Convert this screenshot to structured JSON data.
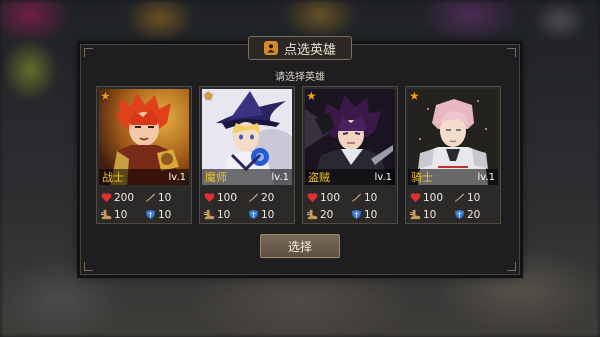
{
  "dialog": {
    "title": "点选英雄",
    "subtitle": "请选择英雄",
    "select_label": "选择"
  },
  "heroes": [
    {
      "name": "战士",
      "level": "lv.1",
      "hp": "200",
      "attack": "10",
      "speed": "10",
      "defense": "10"
    },
    {
      "name": "魔师",
      "level": "lv.1",
      "hp": "100",
      "attack": "20",
      "speed": "10",
      "defense": "10"
    },
    {
      "name": "盗贼",
      "level": "lv.1",
      "hp": "100",
      "attack": "10",
      "speed": "20",
      "defense": "10"
    },
    {
      "name": "骑士",
      "level": "lv.1",
      "hp": "100",
      "attack": "10",
      "speed": "10",
      "defense": "20"
    }
  ],
  "icons": {
    "title": "hero-badge-icon",
    "rarity": "star-icon",
    "hp": "heart-icon",
    "attack": "sword-icon",
    "speed": "boot-icon",
    "defense": "shield-icon"
  },
  "colors": {
    "accent": "#f2c42a",
    "star": "#f0a020",
    "hp": "#e03030",
    "defense": "#3a7ad8",
    "button": "#6e604e"
  }
}
